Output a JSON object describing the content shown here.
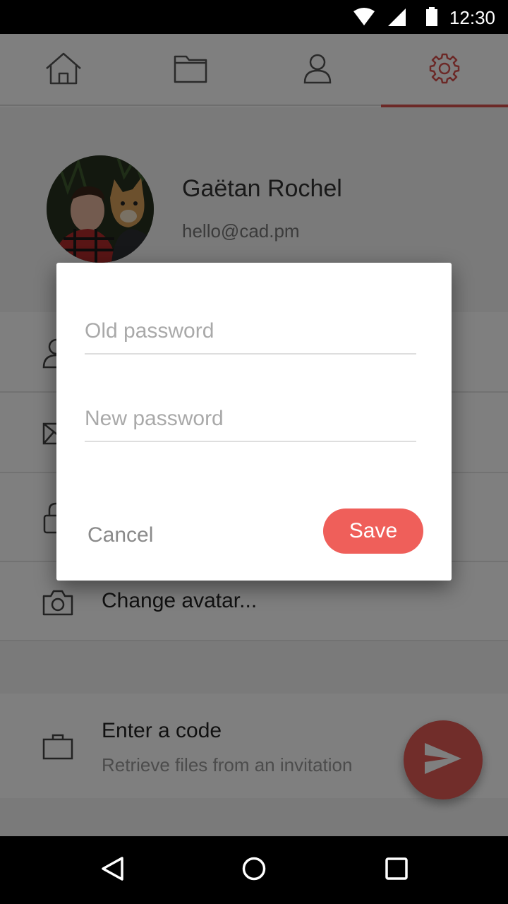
{
  "status_bar": {
    "time": "12:30",
    "icons": [
      "wifi-icon",
      "cell-signal-icon",
      "battery-icon"
    ]
  },
  "tabs": [
    {
      "name": "home",
      "icon": "home-icon",
      "active": false
    },
    {
      "name": "files",
      "icon": "folder-icon",
      "active": false
    },
    {
      "name": "contacts",
      "icon": "person-icon",
      "active": false
    },
    {
      "name": "settings",
      "icon": "gear-icon",
      "active": true
    }
  ],
  "colors": {
    "accent": "#e25a55",
    "save_button": "#ef5f5a",
    "active_tab": "#d9534f"
  },
  "profile": {
    "name": "Gaëtan Rochel",
    "email": "hello@cad.pm"
  },
  "settings_list": {
    "change_avatar_label": "Change avatar...",
    "enter_code_label": "Enter a code",
    "enter_code_sub": "Retrieve files from an invitation"
  },
  "dialog": {
    "old_password_placeholder": "Old password",
    "new_password_placeholder": "New password",
    "old_password_value": "",
    "new_password_value": "",
    "cancel_label": "Cancel",
    "save_label": "Save"
  },
  "nav_bar": {
    "buttons": [
      "back-icon",
      "home-circle-icon",
      "recents-icon"
    ]
  }
}
